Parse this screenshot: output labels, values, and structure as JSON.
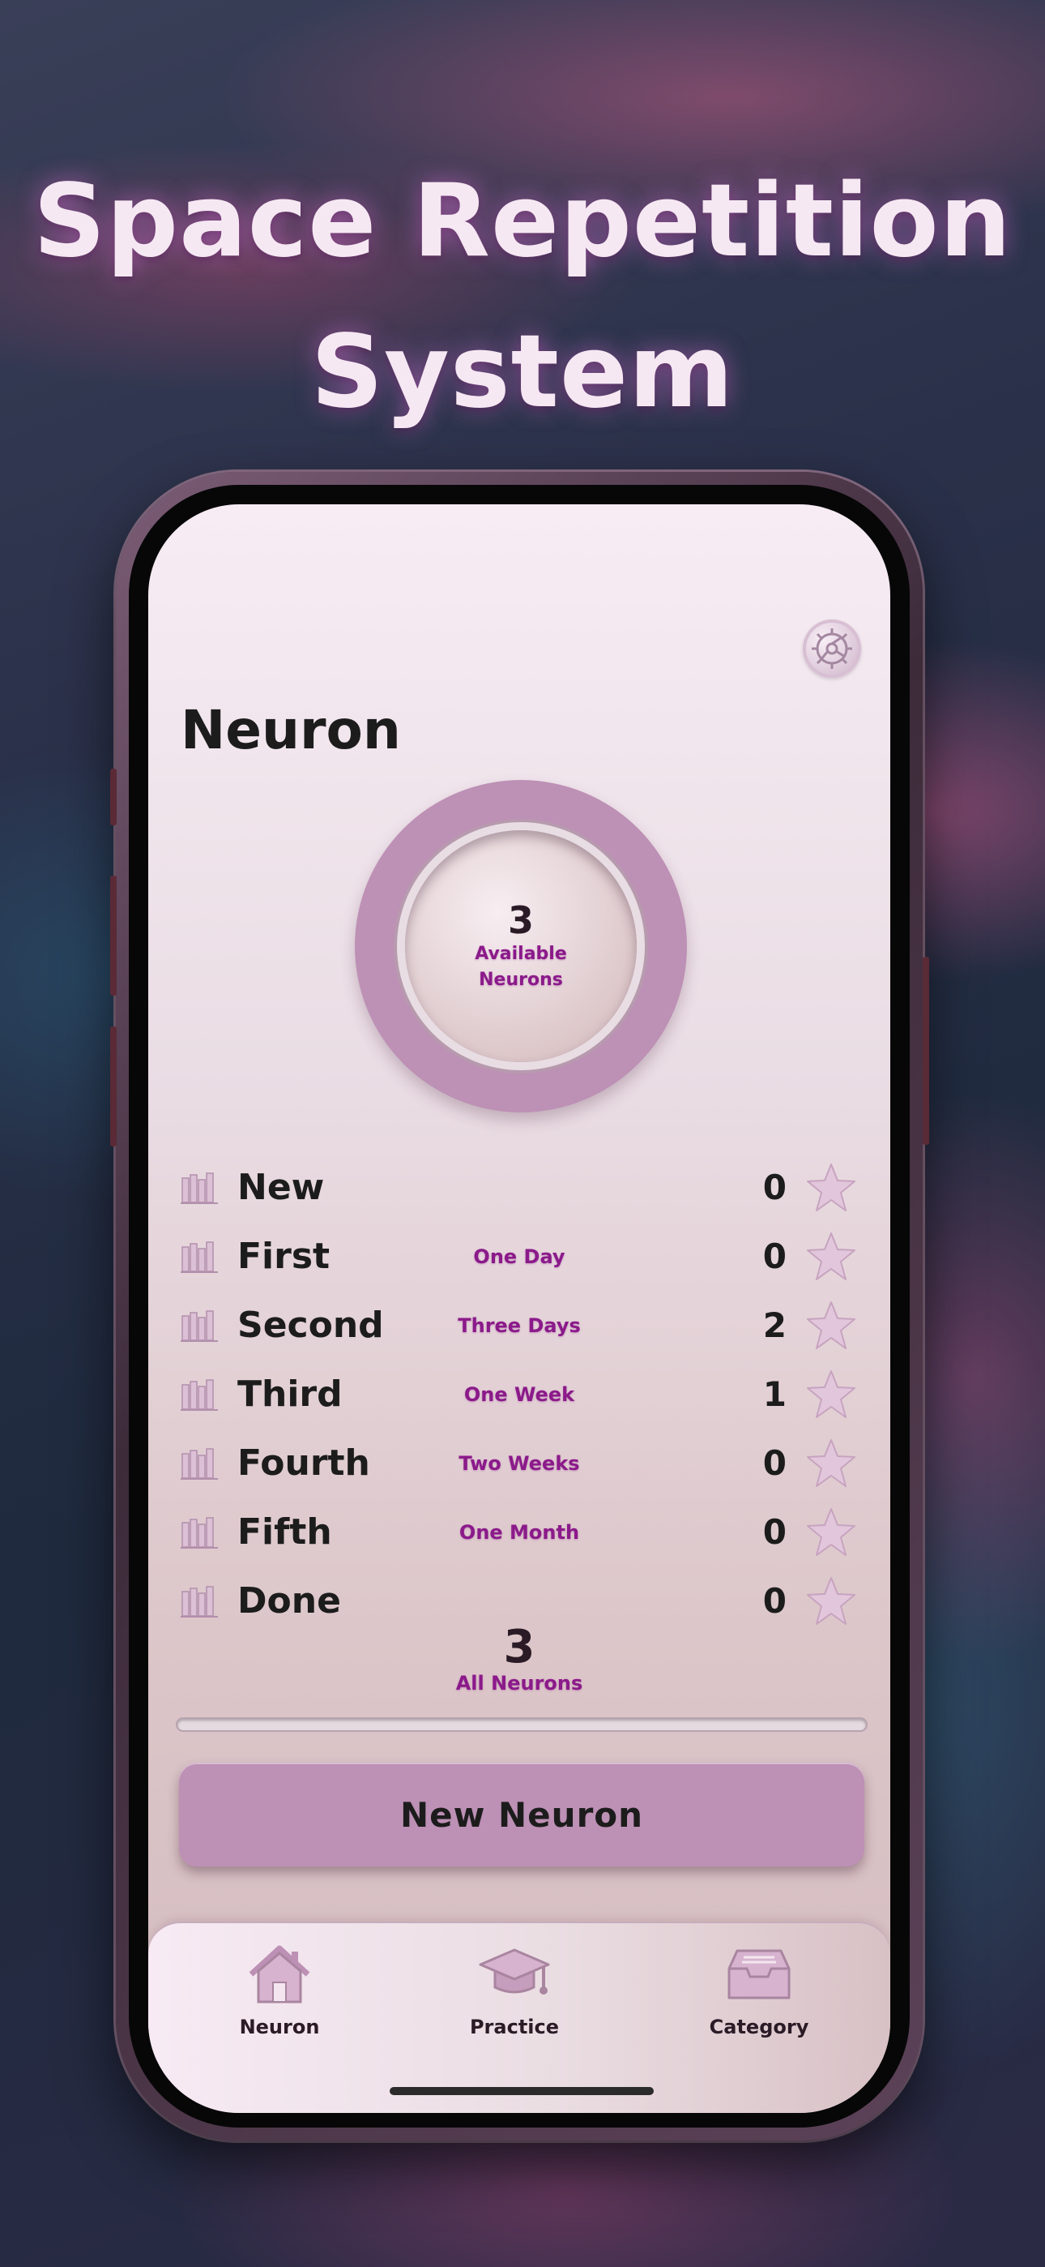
{
  "headline": {
    "line1": "Space Repetition",
    "line2": "System"
  },
  "app": {
    "title": "Neuron"
  },
  "summary": {
    "available_count": "3",
    "available_label_line1": "Available",
    "available_label_line2": "Neurons"
  },
  "levels": [
    {
      "name": "New",
      "interval": "",
      "count": "0"
    },
    {
      "name": "First",
      "interval": "One Day",
      "count": "0"
    },
    {
      "name": "Second",
      "interval": "Three Days",
      "count": "2"
    },
    {
      "name": "Third",
      "interval": "One Week",
      "count": "1"
    },
    {
      "name": "Fourth",
      "interval": "Two Weeks",
      "count": "0"
    },
    {
      "name": "Fifth",
      "interval": "One Month",
      "count": "0"
    },
    {
      "name": "Done",
      "interval": "",
      "count": "0"
    }
  ],
  "total": {
    "count": "3",
    "label": "All Neurons",
    "progress": 0
  },
  "actions": {
    "new_neuron": "New Neuron"
  },
  "tabbar": {
    "items": [
      {
        "label": "Neuron",
        "icon": "home-icon"
      },
      {
        "label": "Practice",
        "icon": "graduation-cap-icon"
      },
      {
        "label": "Category",
        "icon": "inbox-tray-icon"
      }
    ]
  },
  "colors": {
    "accent": "#bd90b5",
    "label": "#8b1a8a"
  }
}
